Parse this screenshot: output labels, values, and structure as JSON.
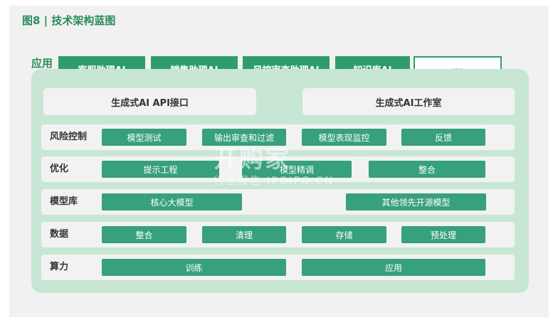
{
  "title": "图8 | 技术架构蓝图",
  "app_label": "应用",
  "app_tabs": [
    "客服助理AI",
    "销售助理AI",
    "风控审查助理AI",
    "知识库AI",
    "..."
  ],
  "interfaces": [
    "生成式AI API接口",
    "生成式AI工作室"
  ],
  "rows": [
    {
      "label": "风险控制",
      "chips": [
        "模型测试",
        "输出审查和过滤",
        "模型表现监控",
        "反馈"
      ]
    },
    {
      "label": "优化",
      "chips": [
        "提示工程",
        "模型精调",
        "整合"
      ]
    },
    {
      "label": "模型库",
      "chips": [
        "核心大模型",
        "其他领先开源模型"
      ]
    },
    {
      "label": "数据",
      "chips": [
        "整合",
        "清理",
        "存储",
        "预处理"
      ]
    },
    {
      "label": "算力",
      "chips": [
        "训练",
        "应用"
      ]
    }
  ],
  "watermark": {
    "main": "开购家",
    "sub": "行业报告 IPOIPO.CN"
  }
}
